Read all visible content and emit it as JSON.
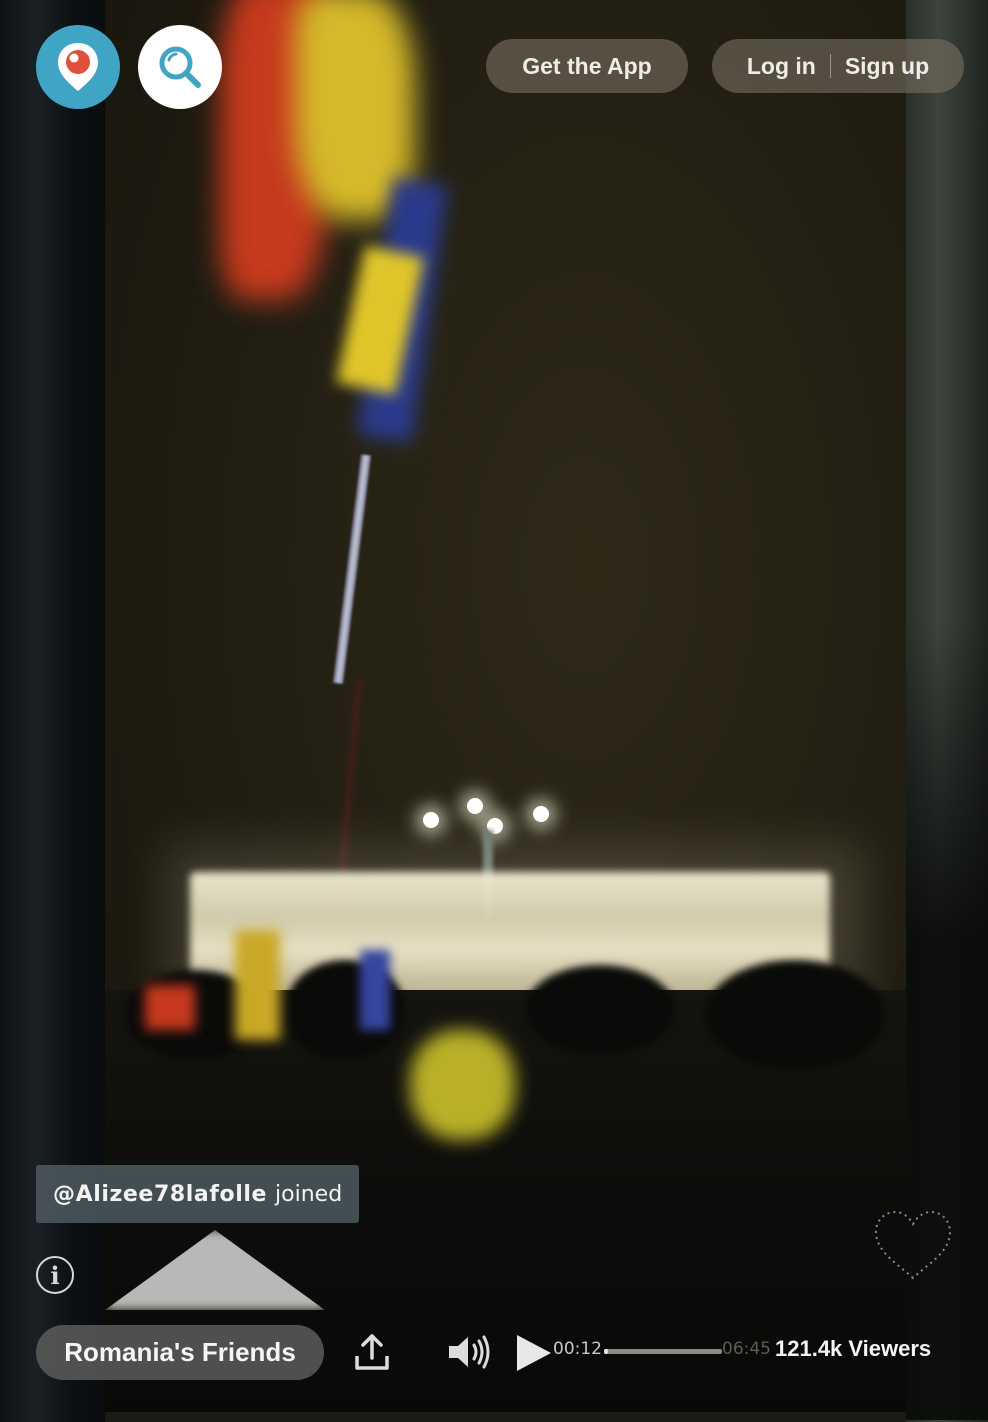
{
  "header": {
    "logo_icon": "periscope-pin-icon",
    "search_icon": "search-icon",
    "get_app_label": "Get the App",
    "login_label": "Log in",
    "signup_label": "Sign up"
  },
  "notification": {
    "username": "@Alizee78lafolle",
    "verb": "joined"
  },
  "broadcast": {
    "channel_name": "Romania's Friends",
    "current_time": "00:12",
    "total_time": "06:45",
    "progress_fraction": 0.03,
    "viewers": "121.4k Viewers"
  },
  "icons": {
    "info": "info-icon",
    "share": "share-icon",
    "volume": "volume-icon",
    "play": "play-icon",
    "heart": "heart-icon"
  },
  "colors": {
    "brand": "#40a4c4",
    "pin_red": "#e0503c",
    "pill_bg": "#78705e"
  }
}
